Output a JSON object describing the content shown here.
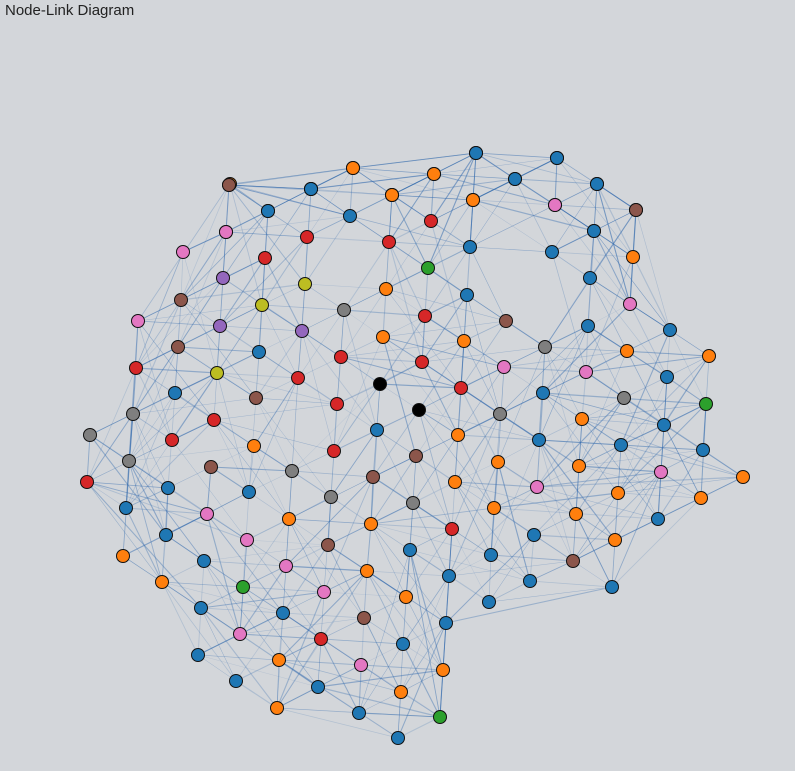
{
  "title": "Node-Link Diagram",
  "palette": {
    "blue": "#1f77b4",
    "orange": "#ff7f0e",
    "green": "#2ca02c",
    "red": "#d62728",
    "purple": "#9467bd",
    "brown": "#8c564b",
    "pink": "#e377c2",
    "gray": "#7f7f7f",
    "olive": "#bcbd22",
    "cyan": "#17becf",
    "black": "#000000"
  },
  "link_color": "#3a6fb0",
  "nodes": [
    {
      "id": "n0",
      "group": "red"
    },
    {
      "id": "n1",
      "group": "blue"
    },
    {
      "id": "n2",
      "group": "brown"
    },
    {
      "id": "n3",
      "group": "red"
    },
    {
      "id": "n4",
      "group": "red"
    },
    {
      "id": "n5",
      "group": "olive"
    },
    {
      "id": "n6",
      "group": "cyan"
    },
    {
      "id": "n7",
      "group": "purple"
    },
    {
      "id": "n8",
      "group": "orange"
    },
    {
      "id": "n9",
      "group": "orange"
    },
    {
      "id": "n10",
      "group": "brown"
    },
    {
      "id": "n11",
      "group": "red"
    },
    {
      "id": "n12",
      "group": "gray"
    },
    {
      "id": "n13",
      "group": "blue"
    },
    {
      "id": "n14",
      "group": "orange"
    },
    {
      "id": "n15",
      "group": "blue"
    },
    {
      "id": "n16",
      "group": "red"
    },
    {
      "id": "n17",
      "group": "blue"
    },
    {
      "id": "n18",
      "group": "blue"
    },
    {
      "id": "n19",
      "group": "orange"
    },
    {
      "id": "n20",
      "group": "pink"
    },
    {
      "id": "n21",
      "group": "red"
    },
    {
      "id": "n22",
      "group": "red"
    },
    {
      "id": "n23",
      "group": "green"
    },
    {
      "id": "n24",
      "group": "red"
    },
    {
      "id": "n25",
      "group": "blue"
    },
    {
      "id": "n26",
      "group": "purple"
    },
    {
      "id": "n27",
      "group": "orange"
    },
    {
      "id": "n28",
      "group": "olive"
    },
    {
      "id": "n29",
      "group": "olive"
    },
    {
      "id": "n30",
      "group": "brown"
    },
    {
      "id": "n31",
      "group": "gray"
    },
    {
      "id": "n32",
      "group": "blue"
    },
    {
      "id": "n33",
      "group": "pink"
    },
    {
      "id": "n34",
      "group": "pink"
    },
    {
      "id": "n35",
      "group": "purple"
    },
    {
      "id": "n36",
      "group": "purple"
    },
    {
      "id": "n37",
      "group": "red"
    },
    {
      "id": "n38",
      "group": "orange"
    },
    {
      "id": "n39",
      "group": "brown"
    },
    {
      "id": "n40",
      "group": "blue"
    },
    {
      "id": "n41",
      "group": "blue"
    },
    {
      "id": "n42",
      "group": "orange"
    },
    {
      "id": "n43",
      "group": "orange"
    },
    {
      "id": "n44",
      "group": "gray"
    },
    {
      "id": "n45",
      "group": "brown"
    },
    {
      "id": "n46",
      "group": "red"
    },
    {
      "id": "n47",
      "group": "red"
    },
    {
      "id": "n48",
      "group": "red"
    },
    {
      "id": "n49",
      "group": "pink"
    },
    {
      "id": "n50",
      "group": "pink"
    },
    {
      "id": "n51",
      "group": "orange"
    },
    {
      "id": "n52",
      "group": "black"
    },
    {
      "id": "n53",
      "group": "black"
    },
    {
      "id": "n54",
      "group": "red"
    },
    {
      "id": "n55",
      "group": "olive"
    },
    {
      "id": "n56",
      "group": "blue"
    },
    {
      "id": "n57",
      "group": "gray"
    },
    {
      "id": "n58",
      "group": "blue"
    },
    {
      "id": "n59",
      "group": "green"
    },
    {
      "id": "n60",
      "group": "gray"
    },
    {
      "id": "n61",
      "group": "brown"
    },
    {
      "id": "n62",
      "group": "red"
    },
    {
      "id": "n63",
      "group": "red"
    },
    {
      "id": "n64",
      "group": "blue"
    },
    {
      "id": "n65",
      "group": "blue"
    },
    {
      "id": "n66",
      "group": "orange"
    },
    {
      "id": "n67",
      "group": "blue"
    },
    {
      "id": "n68",
      "group": "orange"
    },
    {
      "id": "n69",
      "group": "gray"
    },
    {
      "id": "n70",
      "group": "gray"
    },
    {
      "id": "n71",
      "group": "red"
    },
    {
      "id": "n72",
      "group": "brown"
    },
    {
      "id": "n73",
      "group": "blue"
    },
    {
      "id": "n74",
      "group": "gray"
    },
    {
      "id": "n75",
      "group": "orange"
    },
    {
      "id": "n76",
      "group": "orange"
    },
    {
      "id": "n77",
      "group": "blue"
    },
    {
      "id": "n78",
      "group": "brown"
    },
    {
      "id": "n79",
      "group": "red"
    },
    {
      "id": "n80",
      "group": "gray"
    },
    {
      "id": "n81",
      "group": "brown"
    },
    {
      "id": "n82",
      "group": "blue"
    },
    {
      "id": "n83",
      "group": "red"
    },
    {
      "id": "n84",
      "group": "pink"
    },
    {
      "id": "n85",
      "group": "orange"
    },
    {
      "id": "n86",
      "group": "pink"
    },
    {
      "id": "n87",
      "group": "gray"
    },
    {
      "id": "n88",
      "group": "orange"
    },
    {
      "id": "n89",
      "group": "red"
    },
    {
      "id": "n90",
      "group": "blue"
    },
    {
      "id": "n91",
      "group": "orange"
    },
    {
      "id": "n92",
      "group": "orange"
    },
    {
      "id": "n93",
      "group": "blue"
    },
    {
      "id": "n94",
      "group": "orange"
    },
    {
      "id": "n95",
      "group": "gray"
    },
    {
      "id": "n96",
      "group": "blue"
    },
    {
      "id": "n97",
      "group": "orange"
    },
    {
      "id": "n98",
      "group": "red"
    },
    {
      "id": "n99",
      "group": "orange"
    },
    {
      "id": "n100",
      "group": "orange"
    },
    {
      "id": "n101",
      "group": "blue"
    },
    {
      "id": "n102",
      "group": "orange"
    },
    {
      "id": "n103",
      "group": "blue"
    },
    {
      "id": "n104",
      "group": "blue"
    },
    {
      "id": "n105",
      "group": "blue"
    },
    {
      "id": "n106",
      "group": "pink"
    },
    {
      "id": "n107",
      "group": "blue"
    },
    {
      "id": "n108",
      "group": "blue"
    },
    {
      "id": "n109",
      "group": "orange"
    },
    {
      "id": "n110",
      "group": "orange"
    },
    {
      "id": "n111",
      "group": "pink"
    },
    {
      "id": "n112",
      "group": "brown"
    },
    {
      "id": "n113",
      "group": "blue"
    },
    {
      "id": "n114",
      "group": "brown"
    },
    {
      "id": "n115",
      "group": "pink"
    },
    {
      "id": "n116",
      "group": "orange"
    },
    {
      "id": "n117",
      "group": "blue"
    },
    {
      "id": "n118",
      "group": "blue"
    },
    {
      "id": "n119",
      "group": "orange"
    },
    {
      "id": "n120",
      "group": "green"
    },
    {
      "id": "n121",
      "group": "orange"
    },
    {
      "id": "n122",
      "group": "blue"
    },
    {
      "id": "n123",
      "group": "pink"
    },
    {
      "id": "n124",
      "group": "blue"
    },
    {
      "id": "n125",
      "group": "blue"
    },
    {
      "id": "n126",
      "group": "blue"
    },
    {
      "id": "n127",
      "group": "brown"
    },
    {
      "id": "n128",
      "group": "blue"
    },
    {
      "id": "n129",
      "group": "pink"
    },
    {
      "id": "n130",
      "group": "red"
    },
    {
      "id": "n131",
      "group": "blue"
    },
    {
      "id": "n132",
      "group": "orange"
    },
    {
      "id": "n133",
      "group": "blue"
    },
    {
      "id": "n134",
      "group": "pink"
    },
    {
      "id": "n135",
      "group": "orange"
    },
    {
      "id": "n136",
      "group": "blue"
    },
    {
      "id": "n137",
      "group": "blue"
    },
    {
      "id": "n138",
      "group": "orange"
    },
    {
      "id": "n139",
      "group": "orange"
    },
    {
      "id": "n140",
      "group": "blue"
    },
    {
      "id": "n141",
      "group": "green"
    },
    {
      "id": "n142",
      "group": "blue"
    },
    {
      "id": "n143",
      "group": "orange"
    },
    {
      "id": "n144",
      "group": "blue"
    },
    {
      "id": "n145",
      "group": "pink"
    },
    {
      "id": "n146",
      "group": "blue"
    },
    {
      "id": "n147",
      "group": "blue"
    },
    {
      "id": "n148",
      "group": "orange"
    },
    {
      "id": "n149",
      "group": "orange"
    },
    {
      "id": "n150",
      "group": "blue"
    },
    {
      "id": "n151",
      "group": "brown"
    },
    {
      "id": "n152",
      "group": "blue"
    },
    {
      "id": "n153",
      "group": "orange"
    },
    {
      "id": "n154",
      "group": "pink"
    },
    {
      "id": "n155",
      "group": "brown"
    },
    {
      "id": "n156",
      "group": "blue"
    },
    {
      "id": "n157",
      "group": "orange"
    },
    {
      "id": "n158",
      "group": "blue"
    },
    {
      "id": "n159",
      "group": "pink"
    },
    {
      "id": "n160",
      "group": "blue"
    }
  ]
}
